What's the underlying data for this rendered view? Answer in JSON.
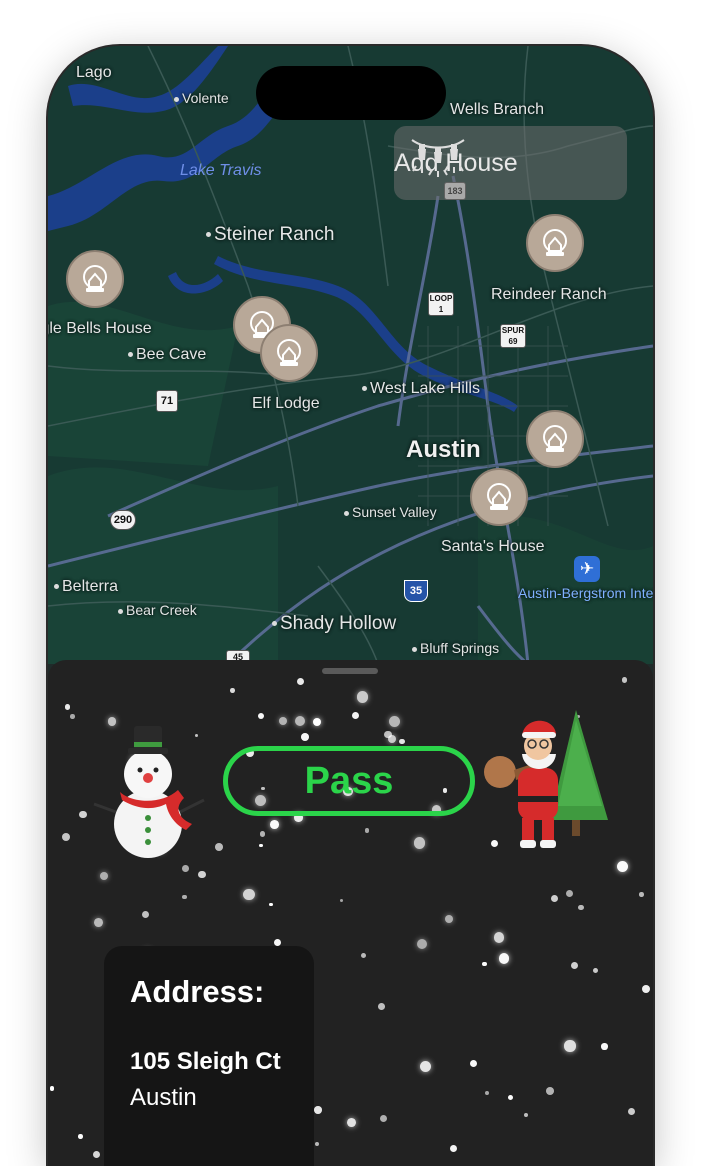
{
  "add_house_label": "Add House",
  "pass_label": "Pass",
  "address": {
    "heading": "Address:",
    "line1": "105 Sleigh Ct",
    "line2": "Austin"
  },
  "map_labels": {
    "volente": "Volente",
    "lago": "Lago",
    "wells_branch": "Wells Branch",
    "lake_travis": "Lake Travis",
    "steiner_ranch": "Steiner Ranch",
    "reindeer_ranch": "Reindeer Ranch",
    "jingle_bells_house": "Jingle Bells House",
    "bee_cave": "Bee Cave",
    "elf_lodge": "Elf Lodge",
    "west_lake_hills": "West Lake Hills",
    "austin": "Austin",
    "sunset_valley": "Sunset Valley",
    "santas_house": "Santa's House",
    "belterra": "Belterra",
    "bear_creek": "Bear Creek",
    "shady_hollow": "Shady Hollow",
    "bluff_springs": "Bluff Springs",
    "airport": "Austin-Bergstrom International Airport (AUS)"
  },
  "shields": {
    "loop1": "LOOP 1",
    "spur69": "SPUR 69",
    "tx71": "71",
    "us290": "290",
    "i35": "35",
    "r183": "183",
    "i45": "45"
  },
  "colors": {
    "accent_green": "#2bd44a",
    "sheet_bg": "#222222",
    "map_bg": "#173a33",
    "pin_fill": "#b8a898"
  }
}
